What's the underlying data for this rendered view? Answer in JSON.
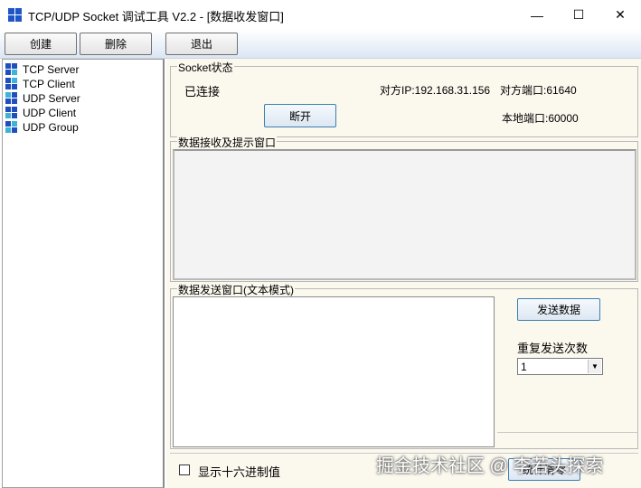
{
  "window": {
    "title": "TCP/UDP Socket 调试工具 V2.2 - [数据收发窗口]",
    "minimize_glyph": "—",
    "maximize_glyph": "☐",
    "close_glyph": "✕"
  },
  "toolbar": {
    "create_label": "创建",
    "delete_label": "删除",
    "exit_label": "退出"
  },
  "sidebar": {
    "items": [
      {
        "label": "TCP Server"
      },
      {
        "label": "TCP Client"
      },
      {
        "label": "UDP Server"
      },
      {
        "label": "UDP Client"
      },
      {
        "label": "UDP Group"
      }
    ]
  },
  "socket_status": {
    "legend": "Socket状态",
    "state": "已连接",
    "remote_ip": "对方IP:192.168.31.156",
    "remote_port": "对方端口:61640",
    "local_port": "本地端口:60000",
    "disconnect_label": "断开"
  },
  "receive": {
    "legend": "数据接收及提示窗口",
    "content": ""
  },
  "send": {
    "legend": "数据发送窗口(文本模式)",
    "content": "",
    "send_label": "发送数据",
    "repeat_label": "重复发送次数",
    "repeat_value": "1"
  },
  "footer": {
    "hex_label": "显示十六进制值",
    "hex_checked": false,
    "clear_stats_label": "统计清零"
  },
  "watermark": "掘金技术社区 @ 李若头探索",
  "colors": {
    "panel_bg": "#fbf8ee",
    "toolbar_gradient_end": "#dbe6f4",
    "button_blue_border": "#3c7fb1"
  }
}
